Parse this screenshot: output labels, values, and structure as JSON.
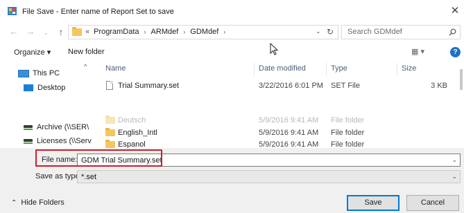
{
  "window": {
    "title": "File Save - Enter name of Report Set to save",
    "close_glyph": "✕"
  },
  "navigation": {
    "back_glyph": "←",
    "forward_glyph": "→",
    "recent_glyph": "⌄",
    "up_glyph": "↑",
    "address_prefix": "«",
    "breadcrumbs": [
      "ProgramData",
      "ARMdef",
      "GDMdef"
    ],
    "crumb_sep": "›",
    "dropdown_glyph": "⌄",
    "refresh_glyph": "↻",
    "search_placeholder": "Search GDMdef"
  },
  "commands": {
    "organize": "Organize ▾",
    "new_folder": "New folder",
    "view_glyph": "▦ ▾",
    "help": "?"
  },
  "nav_pane": {
    "scroll_up": "^",
    "items": [
      {
        "label": "This PC",
        "icon": "computer-icon"
      },
      {
        "label": "Desktop",
        "icon": "desktop-icon"
      },
      {
        "label": "Archive (\\\\SER\\",
        "icon": "network-drive-icon"
      },
      {
        "label": "Licenses (\\\\Serv",
        "icon": "network-drive-icon"
      }
    ]
  },
  "file_list": {
    "columns": {
      "name": "Name",
      "date": "Date modified",
      "type": "Type",
      "size": "Size"
    },
    "rows": [
      {
        "name": "Trial Summary.set",
        "date": "3/22/2016 6:01 PM",
        "type": "SET File",
        "size": "3 KB",
        "kind": "file",
        "faded": false
      },
      {
        "name": "Deutsch",
        "date": "5/9/2016 9:41 AM",
        "type": "File folder",
        "size": "",
        "kind": "folder",
        "faded": true
      },
      {
        "name": "English_Intl",
        "date": "5/9/2016 9:41 AM",
        "type": "File folder",
        "size": "",
        "kind": "folder",
        "faded": false
      },
      {
        "name": "Espanol",
        "date": "5/9/2016 9:41 AM",
        "type": "File folder",
        "size": "",
        "kind": "folder",
        "faded": false
      }
    ]
  },
  "form": {
    "file_name_label": "File name:",
    "file_name_value": "GDM Trial Summary.set",
    "save_as_type_label": "Save as type:",
    "save_as_type_value": "*.set",
    "dd_glyph": "⌄"
  },
  "footer": {
    "hide_folders": "Hide Folders",
    "hide_glyph": "⌃",
    "save": "Save",
    "cancel": "Cancel"
  },
  "colors": {
    "highlight": "#c8202b",
    "accent": "#0078d7",
    "folder": "#f3c760"
  }
}
